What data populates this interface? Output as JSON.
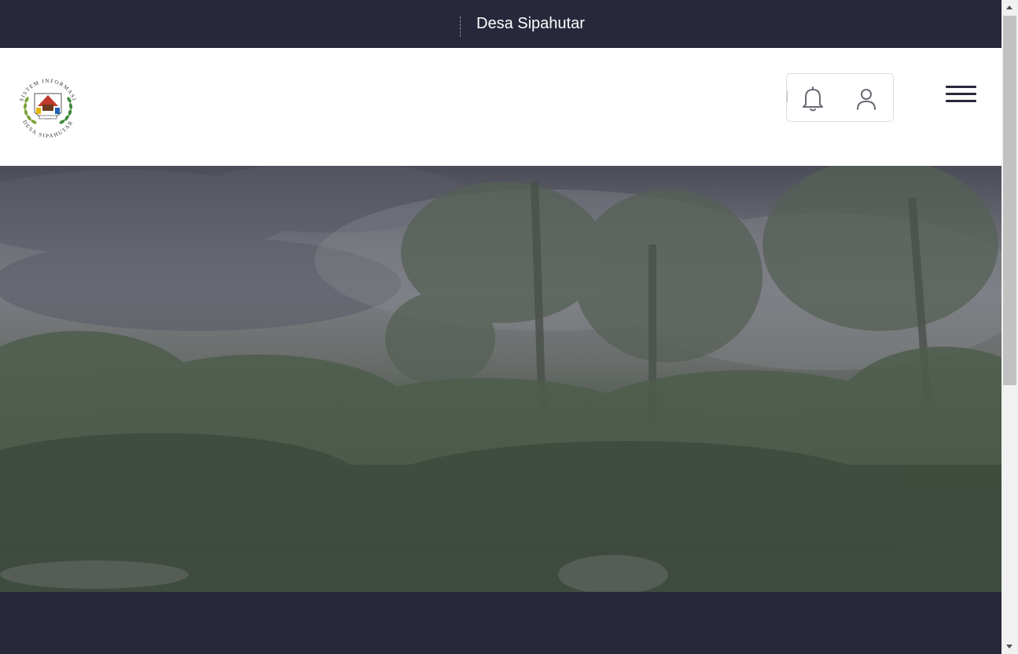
{
  "topbar": {
    "site_title": "Desa Sipahutar"
  },
  "logo": {
    "ring_text_top": "SISTEM INFORMASI",
    "ring_text_bottom": "DESA SIPAHUTAR"
  },
  "header_actions": {
    "notification_icon": "bell-icon",
    "account_icon": "user-icon",
    "menu_icon": "hamburger-menu-icon"
  },
  "hero": {
    "image": "foggy-village-landscape"
  },
  "colors": {
    "dark_navy": "#27283b",
    "white": "#ffffff"
  }
}
